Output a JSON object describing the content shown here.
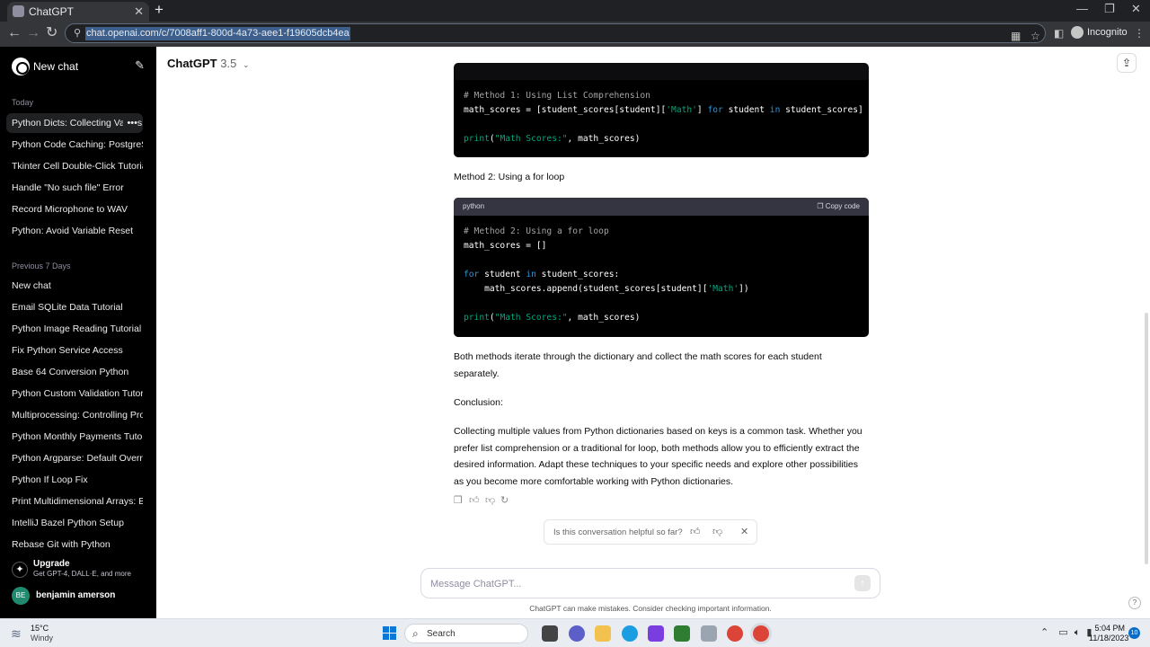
{
  "browser": {
    "tab_title": "ChatGPT",
    "url": "chat.openai.com/c/7008aff1-800d-4a73-aee1-f19605dcb4ea",
    "incognito_label": "Incognito"
  },
  "sidebar": {
    "new_chat_label": "New chat",
    "today_label": "Today",
    "today_items": [
      {
        "label": "Python Dicts: Collecting Values"
      },
      {
        "label": "Python Code Caching: PostgreSQL"
      },
      {
        "label": "Tkinter Cell Double-Click Tutorial"
      },
      {
        "label": "Handle \"No such file\" Error"
      },
      {
        "label": "Record Microphone to WAV"
      },
      {
        "label": "Python: Avoid Variable Reset"
      }
    ],
    "prev7_label": "Previous 7 Days",
    "prev7_items": [
      {
        "label": "New chat"
      },
      {
        "label": "Email SQLite Data Tutorial"
      },
      {
        "label": "Python Image Reading Tutorial"
      },
      {
        "label": "Fix Python Service Access"
      },
      {
        "label": "Base 64 Conversion Python"
      },
      {
        "label": "Python Custom Validation Tutorial"
      },
      {
        "label": "Multiprocessing: Controlling Processes"
      },
      {
        "label": "Python Monthly Payments Tutorial"
      },
      {
        "label": "Python Argparse: Default Override"
      },
      {
        "label": "Python If Loop Fix"
      },
      {
        "label": "Print Multidimensional Arrays: Be"
      },
      {
        "label": "IntelliJ Bazel Python Setup"
      },
      {
        "label": "Rebase Git with Python"
      }
    ],
    "upgrade_title": "Upgrade",
    "upgrade_subtitle": "Get GPT-4, DALL·E, and more",
    "user_initials": "BE",
    "user_name": "benjamin amerson"
  },
  "header": {
    "model_name": "ChatGPT",
    "model_version": "3.5"
  },
  "content": {
    "code1": {
      "lines": [
        "# Method 1: Using List Comprehension",
        "math_scores = [student_scores[student]['Math'] for student in student_scores]",
        "",
        "print(\"Math Scores:\", math_scores)"
      ]
    },
    "method2_heading": "Method 2: Using a for loop",
    "code2": {
      "language": "python",
      "copy_label": "Copy code",
      "lines": [
        "# Method 2: Using a for loop",
        "math_scores = []",
        "",
        "for student in student_scores:",
        "    math_scores.append(student_scores[student]['Math'])",
        "",
        "print(\"Math Scores:\", math_scores)"
      ]
    },
    "para_both": "Both methods iterate through the dictionary and collect the math scores for each student separately.",
    "conclusion_heading": "Conclusion:",
    "para_conclusion": "Collecting multiple values from Python dictionaries based on keys is a common task. Whether you prefer list comprehension or a traditional for loop, both methods allow you to efficiently extract the desired information. Adapt these techniques to your specific needs and explore other possibilities as you become more comfortable working with Python dictionaries."
  },
  "feedback": {
    "question": "Is this conversation helpful so far?"
  },
  "composer": {
    "placeholder": "Message ChatGPT...",
    "disclaimer": "ChatGPT can make mistakes. Consider checking important information."
  },
  "taskbar": {
    "temperature": "15°C",
    "condition": "Windy",
    "search_label": "Search",
    "time": "5:04 PM",
    "date": "11/18/2023",
    "notification_count": "10"
  },
  "colors": {
    "sidebar_bg": "#000000",
    "code_bg": "#000000",
    "code_keyword": "#2e95d3",
    "code_string": "#00a67d",
    "code_comment": "#a3a3a3",
    "avatar_bg": "#1f8a70"
  }
}
